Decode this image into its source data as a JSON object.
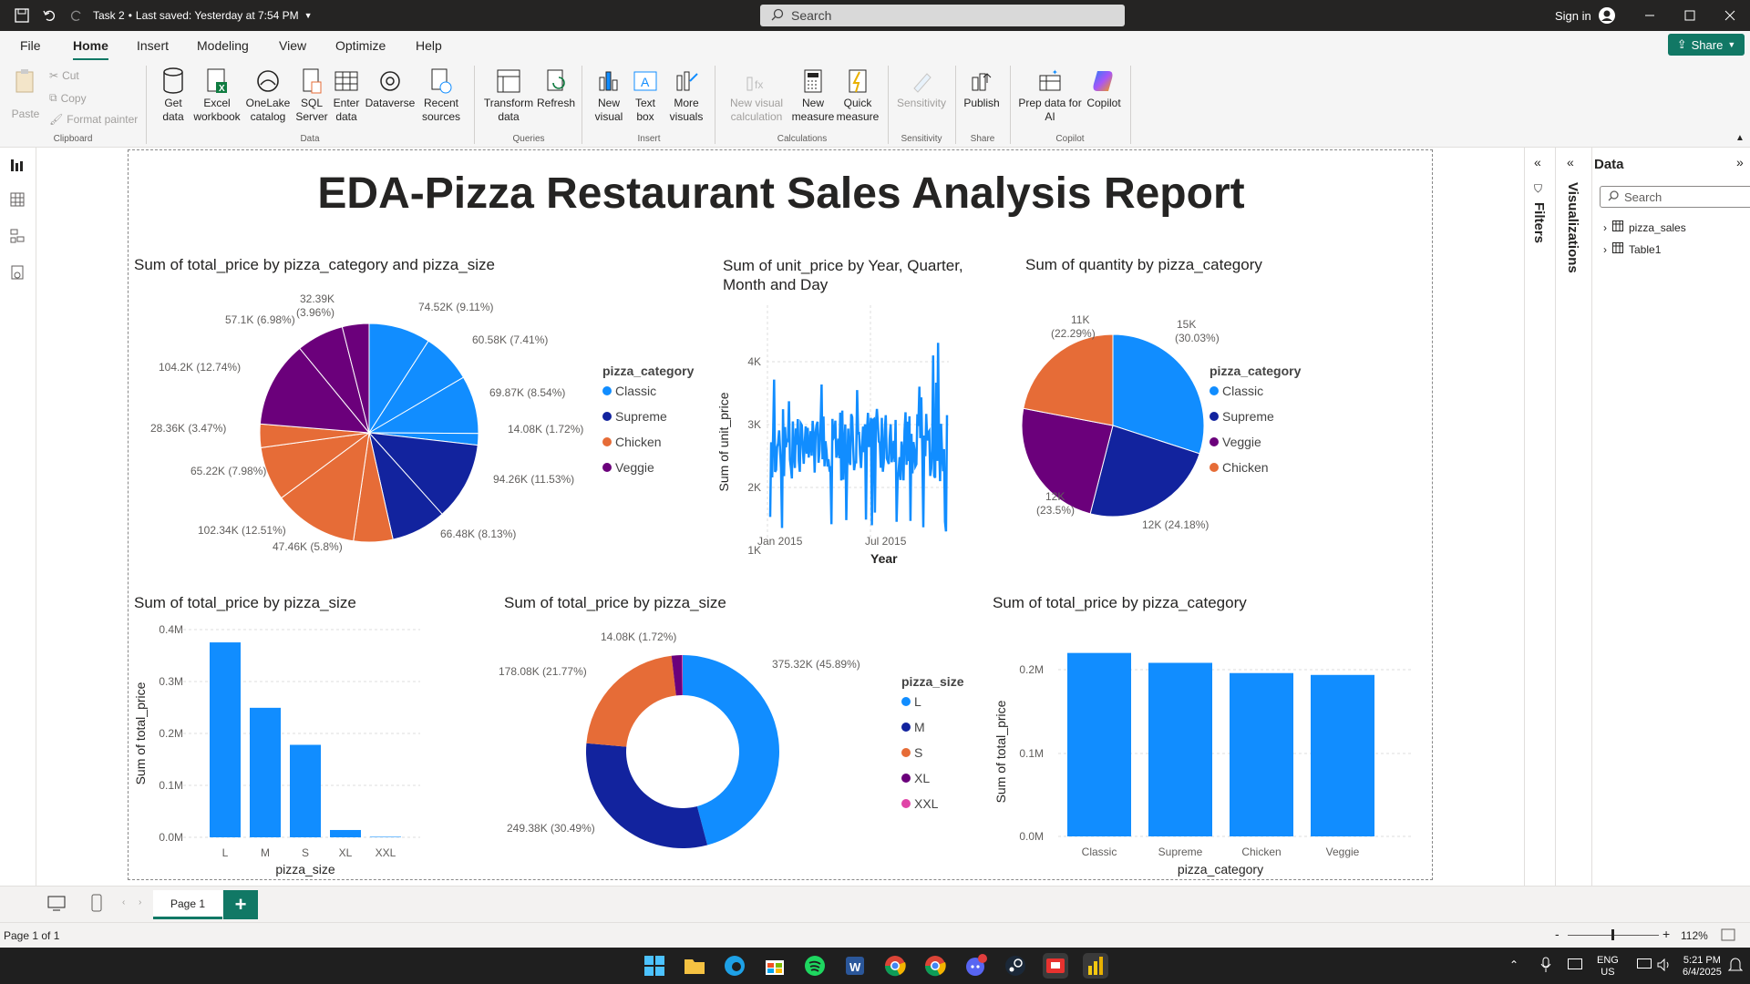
{
  "titlebar": {
    "doc": "Task 2",
    "saved": "Last saved: Yesterday at 7:54 PM",
    "search_placeholder": "Search",
    "sign_in": "Sign in"
  },
  "menu": [
    "File",
    "Home",
    "Insert",
    "Modeling",
    "View",
    "Optimize",
    "Help"
  ],
  "share": "Share",
  "ribbon": {
    "clipboard": {
      "paste": "Paste",
      "cut": "Cut",
      "copy": "Copy",
      "format_painter": "Format painter",
      "group": "Clipboard"
    },
    "data": {
      "get": "Get data",
      "excel": "Excel workbook",
      "onelake": "OneLake catalog",
      "sql": "SQL Server",
      "enter": "Enter data",
      "dataverse": "Dataverse",
      "recent": "Recent sources",
      "group": "Data"
    },
    "queries": {
      "transform": "Transform data",
      "refresh": "Refresh",
      "group": "Queries"
    },
    "insert": {
      "new_visual": "New visual",
      "text_box": "Text box",
      "more_visuals": "More visuals",
      "group": "Insert"
    },
    "calculations": {
      "new_visual_calc": "New visual calculation",
      "new_measure": "New measure",
      "quick_measure": "Quick measure",
      "group": "Calculations"
    },
    "sensitivity": {
      "label": "Sensitivity",
      "group": "Sensitivity"
    },
    "share": {
      "publish": "Publish",
      "group": "Share"
    },
    "copilot": {
      "prep": "Prep data for AI",
      "copilot": "Copilot",
      "group": "Copilot"
    }
  },
  "report_title": "EDA-Pizza Restaurant Sales Analysis Report",
  "colors": {
    "classic": "#118DFF",
    "supreme": "#12239E",
    "chicken": "#E66C37",
    "veggie": "#6B007B",
    "xxl": "#E044A7",
    "accent": "#117865"
  },
  "visuals": {
    "pie1": {
      "title": "Sum of total_price by pizza_category and pizza_size",
      "legend_title": "pizza_category",
      "legend": [
        "Classic",
        "Supreme",
        "Chicken",
        "Veggie"
      ],
      "labels": [
        "74.52K (9.11%)",
        "60.58K (7.41%)",
        "69.87K (8.54%)",
        "14.08K (1.72%)",
        "94.26K (11.53%)",
        "66.48K (8.13%)",
        "47.46K (5.8%)",
        "102.34K (12.51%)",
        "65.22K (7.98%)",
        "28.36K (3.47%)",
        "104.2K (12.74%)",
        "57.1K (6.98%)",
        "32.39K",
        "(3.96%)"
      ]
    },
    "line": {
      "title": "Sum of unit_price by Year, Quarter, Month and Day",
      "xlabel": "Year",
      "ylabel": "Sum of unit_price",
      "xticks": [
        "Jan 2015",
        "Jul 2015"
      ],
      "yticks": [
        "1K",
        "2K",
        "3K",
        "4K"
      ]
    },
    "pie2": {
      "title": "Sum of quantity by pizza_category",
      "legend_title": "pizza_category",
      "legend": [
        "Classic",
        "Supreme",
        "Veggie",
        "Chicken"
      ],
      "labels": [
        "15K",
        "(30.03%)",
        "12K (24.18%)",
        "12K",
        "(23.5%)",
        "11K",
        "(22.29%)"
      ]
    },
    "bar1": {
      "title": "Sum of total_price by pizza_size",
      "xlabel": "pizza_size",
      "ylabel": "Sum of total_price",
      "yticks": [
        "0.0M",
        "0.1M",
        "0.2M",
        "0.3M",
        "0.4M"
      ],
      "categories": [
        "L",
        "M",
        "S",
        "XL",
        "XXL"
      ]
    },
    "donut": {
      "title": "Sum of total_price by pizza_size",
      "legend_title": "pizza_size",
      "legend": [
        "L",
        "M",
        "S",
        "XL",
        "XXL"
      ],
      "labels": [
        "375.32K (45.89%)",
        "249.38K (30.49%)",
        "178.08K (21.77%)",
        "14.08K (1.72%)"
      ]
    },
    "bar2": {
      "title": "Sum of total_price by pizza_category",
      "xlabel": "pizza_category",
      "ylabel": "Sum of total_price",
      "yticks": [
        "0.0M",
        "0.1M",
        "0.2M"
      ],
      "categories": [
        "Classic",
        "Supreme",
        "Chicken",
        "Veggie"
      ]
    }
  },
  "chart_data": [
    {
      "type": "pie",
      "title": "Sum of total_price by pizza_category and pizza_size",
      "series": [
        {
          "name": "Classic",
          "values": [
            74520,
            60580,
            69870,
            14080
          ]
        },
        {
          "name": "Supreme",
          "values": [
            94260,
            66480
          ]
        },
        {
          "name": "Chicken",
          "values": [
            47460,
            102340,
            65220,
            28360
          ]
        },
        {
          "name": "Veggie",
          "values": [
            104200,
            57100,
            32390
          ]
        }
      ]
    },
    {
      "type": "line",
      "title": "Sum of unit_price by Year, Quarter, Month and Day",
      "xlabel": "Year",
      "ylabel": "Sum of unit_price",
      "ylim": [
        1000,
        4300
      ]
    },
    {
      "type": "pie",
      "title": "Sum of quantity by pizza_category",
      "categories": [
        "Classic",
        "Supreme",
        "Veggie",
        "Chicken"
      ],
      "values": [
        15000,
        12000,
        12000,
        11000
      ]
    },
    {
      "type": "bar",
      "title": "Sum of total_price by pizza_size",
      "categories": [
        "L",
        "M",
        "S",
        "XL",
        "XXL"
      ],
      "values": [
        375320,
        249380,
        178080,
        14080,
        1010
      ],
      "xlabel": "pizza_size",
      "ylabel": "Sum of total_price",
      "ylim": [
        0,
        400000
      ]
    },
    {
      "type": "pie",
      "title": "Sum of total_price by pizza_size",
      "categories": [
        "L",
        "M",
        "S",
        "XL",
        "XXL"
      ],
      "values": [
        375320,
        249380,
        178080,
        14080,
        1010
      ]
    },
    {
      "type": "bar",
      "title": "Sum of total_price by pizza_category",
      "categories": [
        "Classic",
        "Supreme",
        "Chicken",
        "Veggie"
      ],
      "values": [
        220050,
        208200,
        195920,
        193690
      ],
      "xlabel": "pizza_category",
      "ylabel": "Sum of total_price",
      "ylim": [
        0,
        220000
      ]
    }
  ],
  "panes": {
    "filters": "Filters",
    "visualizations": "Visualizations",
    "data_title": "Data",
    "search": "Search",
    "tables": [
      "pizza_sales",
      "Table1"
    ]
  },
  "page_tab": "Page 1",
  "status": {
    "page": "Page 1 of 1",
    "zoom": "112%"
  },
  "clock": {
    "lang1": "ENG",
    "lang2": "US",
    "time": "5:21 PM",
    "date": "6/4/2025"
  }
}
